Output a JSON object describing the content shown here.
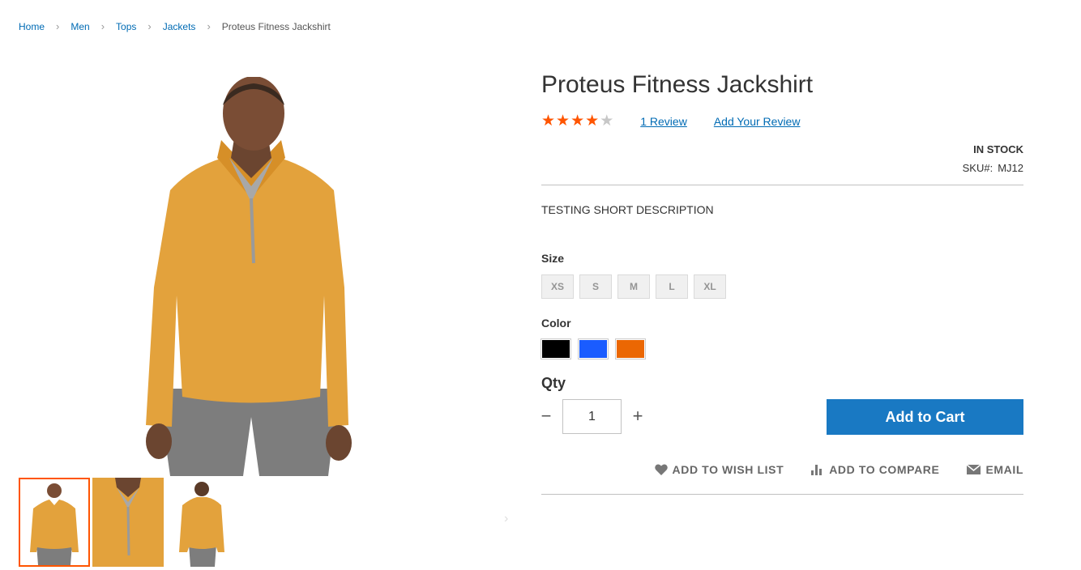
{
  "breadcrumb": {
    "items": [
      "Home",
      "Men",
      "Tops",
      "Jackets"
    ],
    "current": "Proteus Fitness Jackshirt"
  },
  "product": {
    "title": "Proteus Fitness Jackshirt",
    "rating": {
      "value": 4,
      "max": 5
    },
    "review_count_label": "1 Review",
    "add_review_label": "Add Your Review",
    "stock_status": "IN STOCK",
    "sku_label": "SKU#:",
    "sku_value": "MJ12",
    "short_description": "TESTING SHORT DESCRIPTION"
  },
  "options": {
    "size_label": "Size",
    "sizes": [
      "XS",
      "S",
      "M",
      "L",
      "XL"
    ],
    "color_label": "Color",
    "colors": [
      "#000000",
      "#1a5cff",
      "#eb6703"
    ]
  },
  "qty": {
    "label": "Qty",
    "value": "1",
    "minus": "−",
    "plus": "+"
  },
  "cart": {
    "add_label": "Add to Cart"
  },
  "actions": {
    "wishlist": "ADD TO WISH LIST",
    "compare": "ADD TO COMPARE",
    "email": "EMAIL"
  },
  "gallery": {
    "thumb_count": 3,
    "active_index": 0,
    "next_arrow": "›"
  },
  "colors": {
    "link": "#006bb4",
    "star": "#ff5501",
    "primary_button": "#1979c3",
    "thumb_active_border": "#ff5501"
  }
}
